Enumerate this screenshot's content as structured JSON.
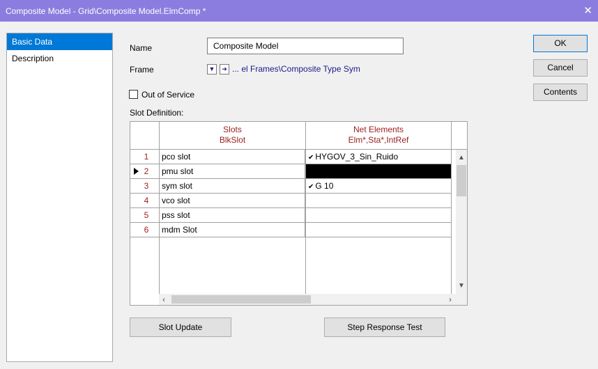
{
  "window": {
    "title": "Composite Model - Grid\\Composite Model.ElmComp *",
    "close_glyph": "✕"
  },
  "nav": {
    "items": [
      {
        "label": "Basic Data",
        "selected": true
      },
      {
        "label": "Description",
        "selected": false
      }
    ]
  },
  "form": {
    "name_label": "Name",
    "name_value": "Composite Model",
    "frame_label": "Frame",
    "frame_value": "... el Frames\\Composite Type Sym",
    "out_of_service_label": "Out of Service",
    "out_of_service_checked": false,
    "slot_definition_label": "Slot Definition:"
  },
  "grid": {
    "columns": [
      {
        "title": "Slots",
        "subtitle": "BlkSlot"
      },
      {
        "title": "Net Elements",
        "subtitle": "Elm*,Sta*,IntRef"
      }
    ],
    "rows": [
      {
        "num": "1",
        "slot": "pco slot",
        "net": "HYGOV_3_Sin_Ruido",
        "checked": true,
        "current": false,
        "selected": false
      },
      {
        "num": "2",
        "slot": "pmu slot",
        "net": "",
        "checked": false,
        "current": true,
        "selected": true
      },
      {
        "num": "3",
        "slot": "sym slot",
        "net": "G 10",
        "checked": true,
        "current": false,
        "selected": false
      },
      {
        "num": "4",
        "slot": "vco slot",
        "net": "",
        "checked": false,
        "current": false,
        "selected": false
      },
      {
        "num": "5",
        "slot": "pss slot",
        "net": "",
        "checked": false,
        "current": false,
        "selected": false
      },
      {
        "num": "6",
        "slot": "mdm Slot",
        "net": "",
        "checked": false,
        "current": false,
        "selected": false
      }
    ]
  },
  "buttons": {
    "ok": "OK",
    "cancel": "Cancel",
    "contents": "Contents",
    "slot_update": "Slot Update",
    "step_response": "Step Response Test"
  },
  "colors": {
    "titlebar": "#8b7ddf",
    "selection": "#0078d7",
    "header_text": "#9b1c1c",
    "link_text": "#1a1a8a"
  }
}
